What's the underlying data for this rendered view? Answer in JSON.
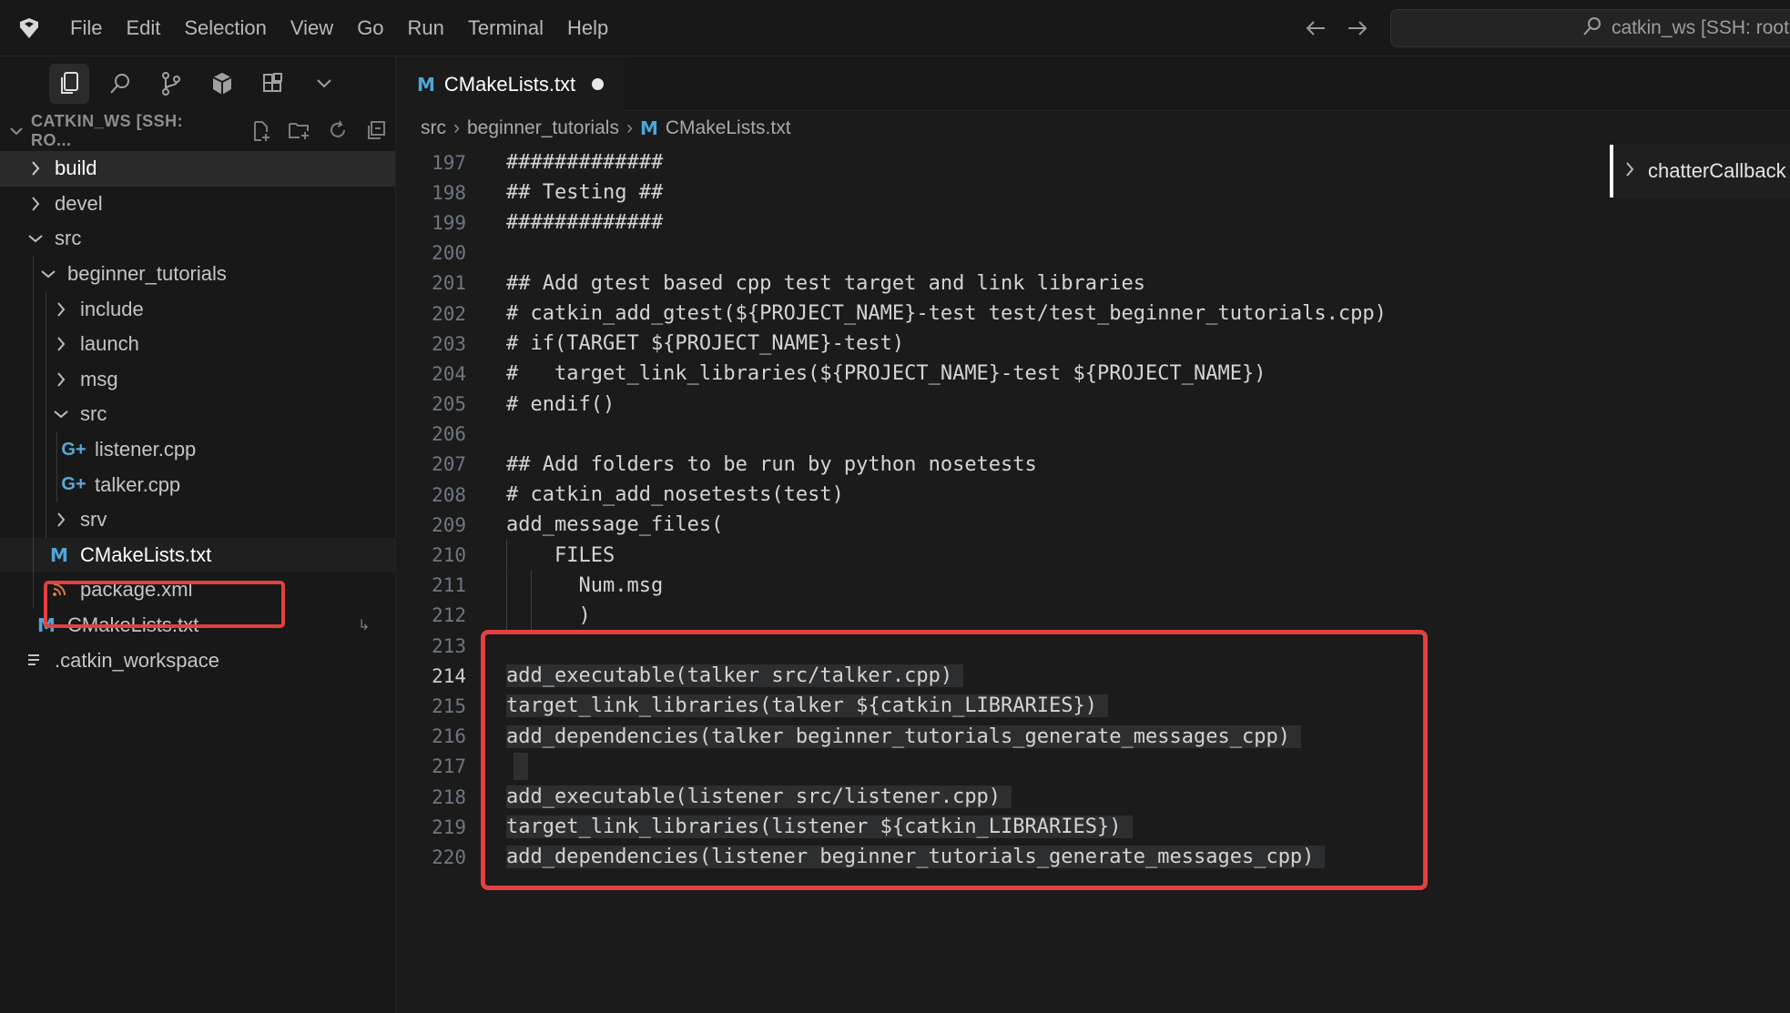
{
  "menu": [
    "File",
    "Edit",
    "Selection",
    "View",
    "Go",
    "Run",
    "Terminal",
    "Help"
  ],
  "command_center": {
    "text": "catkin_ws [SSH: root@"
  },
  "activity_tabs": [
    "explorer-icon",
    "search-icon",
    "source-control-icon",
    "package-icon",
    "extensions-icon",
    "chevron-down-icon"
  ],
  "explorer": {
    "title": "CATKIN_WS [SSH: RO...",
    "actions": [
      "new-file-icon",
      "new-folder-icon",
      "refresh-icon",
      "collapse-all-icon"
    ],
    "items": [
      {
        "label": "build",
        "kind": "folder",
        "state": "collapsed"
      },
      {
        "label": "devel",
        "kind": "folder",
        "state": "collapsed"
      },
      {
        "label": "src",
        "kind": "folder",
        "state": "expanded"
      },
      {
        "label": "beginner_tutorials",
        "kind": "folder",
        "state": "expanded"
      },
      {
        "label": "include",
        "kind": "folder",
        "state": "collapsed"
      },
      {
        "label": "launch",
        "kind": "folder",
        "state": "collapsed"
      },
      {
        "label": "msg",
        "kind": "folder",
        "state": "collapsed"
      },
      {
        "label": "src",
        "kind": "folder",
        "state": "expanded"
      },
      {
        "label": "listener.cpp",
        "kind": "cpp"
      },
      {
        "label": "talker.cpp",
        "kind": "cpp"
      },
      {
        "label": "srv",
        "kind": "folder",
        "state": "collapsed"
      },
      {
        "label": "CMakeLists.txt",
        "kind": "cmake"
      },
      {
        "label": "package.xml",
        "kind": "xml"
      },
      {
        "label": "CMakeLists.txt",
        "kind": "cmake"
      },
      {
        "label": ".catkin_workspace",
        "kind": "text"
      }
    ]
  },
  "editor": {
    "tab_label": "CMakeLists.txt",
    "breadcrumb": [
      "src",
      "beginner_tutorials",
      "CMakeLists.txt"
    ],
    "sticky_outline": "chatterCallback",
    "current_line": "214",
    "lines": [
      {
        "n": "197",
        "text": "#############"
      },
      {
        "n": "198",
        "text": "## Testing ##"
      },
      {
        "n": "199",
        "text": "#############"
      },
      {
        "n": "200",
        "text": ""
      },
      {
        "n": "201",
        "text": "## Add gtest based cpp test target and link libraries"
      },
      {
        "n": "202",
        "text": "# catkin_add_gtest(${PROJECT_NAME}-test test/test_beginner_tutorials.cpp)"
      },
      {
        "n": "203",
        "text": "# if(TARGET ${PROJECT_NAME}-test)"
      },
      {
        "n": "204",
        "text": "#   target_link_libraries(${PROJECT_NAME}-test ${PROJECT_NAME})"
      },
      {
        "n": "205",
        "text": "# endif()"
      },
      {
        "n": "206",
        "text": ""
      },
      {
        "n": "207",
        "text": "## Add folders to be run by python nosetests"
      },
      {
        "n": "208",
        "text": "# catkin_add_nosetests(test)"
      },
      {
        "n": "209",
        "text": "add_message_files("
      },
      {
        "n": "210",
        "text": "    FILES"
      },
      {
        "n": "211",
        "text": "      Num.msg"
      },
      {
        "n": "212",
        "text": "      )"
      },
      {
        "n": "213",
        "text": ""
      },
      {
        "n": "214",
        "text": "add_executable(talker src/talker.cpp)"
      },
      {
        "n": "215",
        "text": "target_link_libraries(talker ${catkin_LIBRARIES})"
      },
      {
        "n": "216",
        "text": "add_dependencies(talker beginner_tutorials_generate_messages_cpp)"
      },
      {
        "n": "217",
        "text": ""
      },
      {
        "n": "218",
        "text": "add_executable(listener src/listener.cpp)"
      },
      {
        "n": "219",
        "text": "target_link_libraries(listener ${catkin_LIBRARIES})"
      },
      {
        "n": "220",
        "text": "add_dependencies(listener beginner_tutorials_generate_messages_cpp)"
      }
    ]
  },
  "colors": {
    "highlight_box": "#e3403f",
    "cmake_icon": "#4fa5d8",
    "xml_icon": "#e07b3a"
  }
}
